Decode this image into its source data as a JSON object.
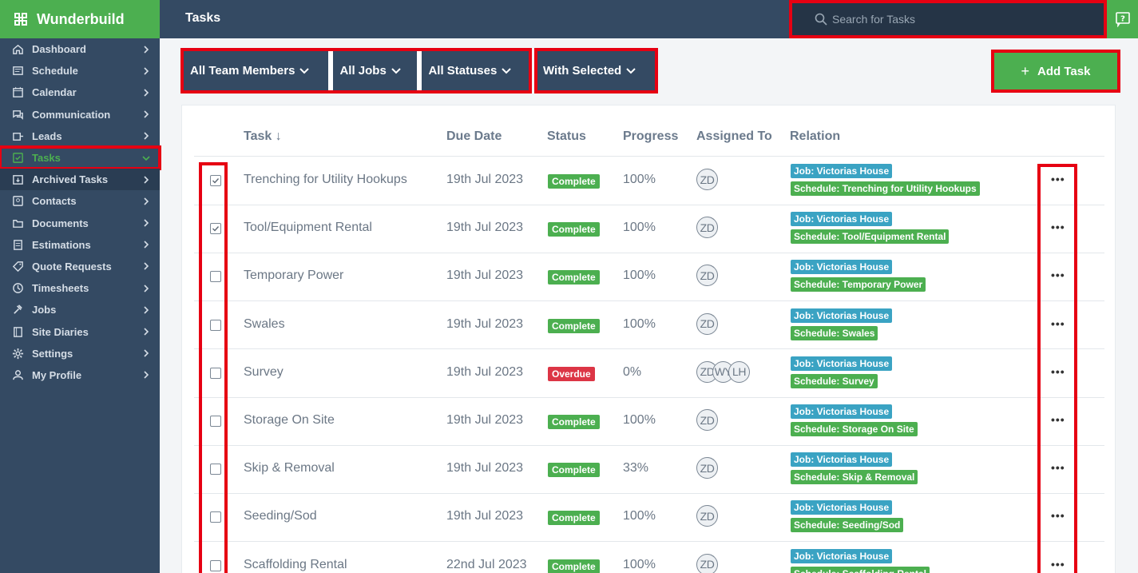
{
  "brand": {
    "name": "Wunderbuild"
  },
  "topbar": {
    "title": "Tasks",
    "search_placeholder": "Search for Tasks"
  },
  "sidebar": {
    "items": [
      {
        "label": "Dashboard",
        "icon": "home-icon"
      },
      {
        "label": "Schedule",
        "icon": "schedule-icon"
      },
      {
        "label": "Calendar",
        "icon": "calendar-icon"
      },
      {
        "label": "Communication",
        "icon": "chat-icon"
      },
      {
        "label": "Leads",
        "icon": "leads-icon"
      },
      {
        "label": "Tasks",
        "icon": "tasks-icon"
      },
      {
        "label": "Archived Tasks",
        "icon": "archive-icon"
      },
      {
        "label": "Contacts",
        "icon": "contacts-icon"
      },
      {
        "label": "Documents",
        "icon": "folder-icon"
      },
      {
        "label": "Estimations",
        "icon": "estimations-icon"
      },
      {
        "label": "Quote Requests",
        "icon": "tag-icon"
      },
      {
        "label": "Timesheets",
        "icon": "clock-icon"
      },
      {
        "label": "Jobs",
        "icon": "hammer-icon"
      },
      {
        "label": "Site Diaries",
        "icon": "book-icon"
      },
      {
        "label": "Settings",
        "icon": "gear-icon"
      },
      {
        "label": "My Profile",
        "icon": "user-icon"
      }
    ]
  },
  "filters": {
    "team_members": "All Team Members",
    "jobs": "All Jobs",
    "statuses": "All Statuses",
    "with_selected": "With Selected"
  },
  "add_task_label": "Add Task",
  "table": {
    "headers": {
      "task": "Task",
      "due_date": "Due Date",
      "status": "Status",
      "progress": "Progress",
      "assigned": "Assigned To",
      "relation": "Relation"
    },
    "rows": [
      {
        "checked": true,
        "task": "Trenching for Utility Hookups",
        "due": "19th Jul 2023",
        "status": "Complete",
        "progress": "100%",
        "assigned": [
          "ZD"
        ],
        "job": "Job: Victorias House",
        "schedule": "Schedule: Trenching for Utility Hookups"
      },
      {
        "checked": true,
        "task": "Tool/Equipment Rental",
        "due": "19th Jul 2023",
        "status": "Complete",
        "progress": "100%",
        "assigned": [
          "ZD"
        ],
        "job": "Job: Victorias House",
        "schedule": "Schedule: Tool/Equipment Rental"
      },
      {
        "checked": false,
        "task": "Temporary Power",
        "due": "19th Jul 2023",
        "status": "Complete",
        "progress": "100%",
        "assigned": [
          "ZD"
        ],
        "job": "Job: Victorias House",
        "schedule": "Schedule: Temporary Power"
      },
      {
        "checked": false,
        "task": "Swales",
        "due": "19th Jul 2023",
        "status": "Complete",
        "progress": "100%",
        "assigned": [
          "ZD"
        ],
        "job": "Job: Victorias House",
        "schedule": "Schedule: Swales"
      },
      {
        "checked": false,
        "task": "Survey",
        "due": "19th Jul 2023",
        "status": "Overdue",
        "progress": "0%",
        "assigned": [
          "ZD",
          "WY",
          "LH"
        ],
        "job": "Job: Victorias House",
        "schedule": "Schedule: Survey"
      },
      {
        "checked": false,
        "task": "Storage On Site",
        "due": "19th Jul 2023",
        "status": "Complete",
        "progress": "100%",
        "assigned": [
          "ZD"
        ],
        "job": "Job: Victorias House",
        "schedule": "Schedule: Storage On Site"
      },
      {
        "checked": false,
        "task": "Skip & Removal",
        "due": "19th Jul 2023",
        "status": "Complete",
        "progress": "33%",
        "assigned": [
          "ZD"
        ],
        "job": "Job: Victorias House",
        "schedule": "Schedule: Skip & Removal"
      },
      {
        "checked": false,
        "task": "Seeding/Sod",
        "due": "19th Jul 2023",
        "status": "Complete",
        "progress": "100%",
        "assigned": [
          "ZD"
        ],
        "job": "Job: Victorias House",
        "schedule": "Schedule: Seeding/Sod"
      },
      {
        "checked": false,
        "task": "Scaffolding Rental",
        "due": "22nd Jul 2023",
        "status": "Complete",
        "progress": "100%",
        "assigned": [
          "ZD"
        ],
        "job": "Job: Victorias House",
        "schedule": "Schedule: Scaffolding Rental"
      }
    ]
  },
  "colors": {
    "sidebar": "#344a63",
    "brand": "#4caf50",
    "highlight": "#e60012",
    "overdue": "#dc3545",
    "job_tag": "#3aa3c3"
  }
}
